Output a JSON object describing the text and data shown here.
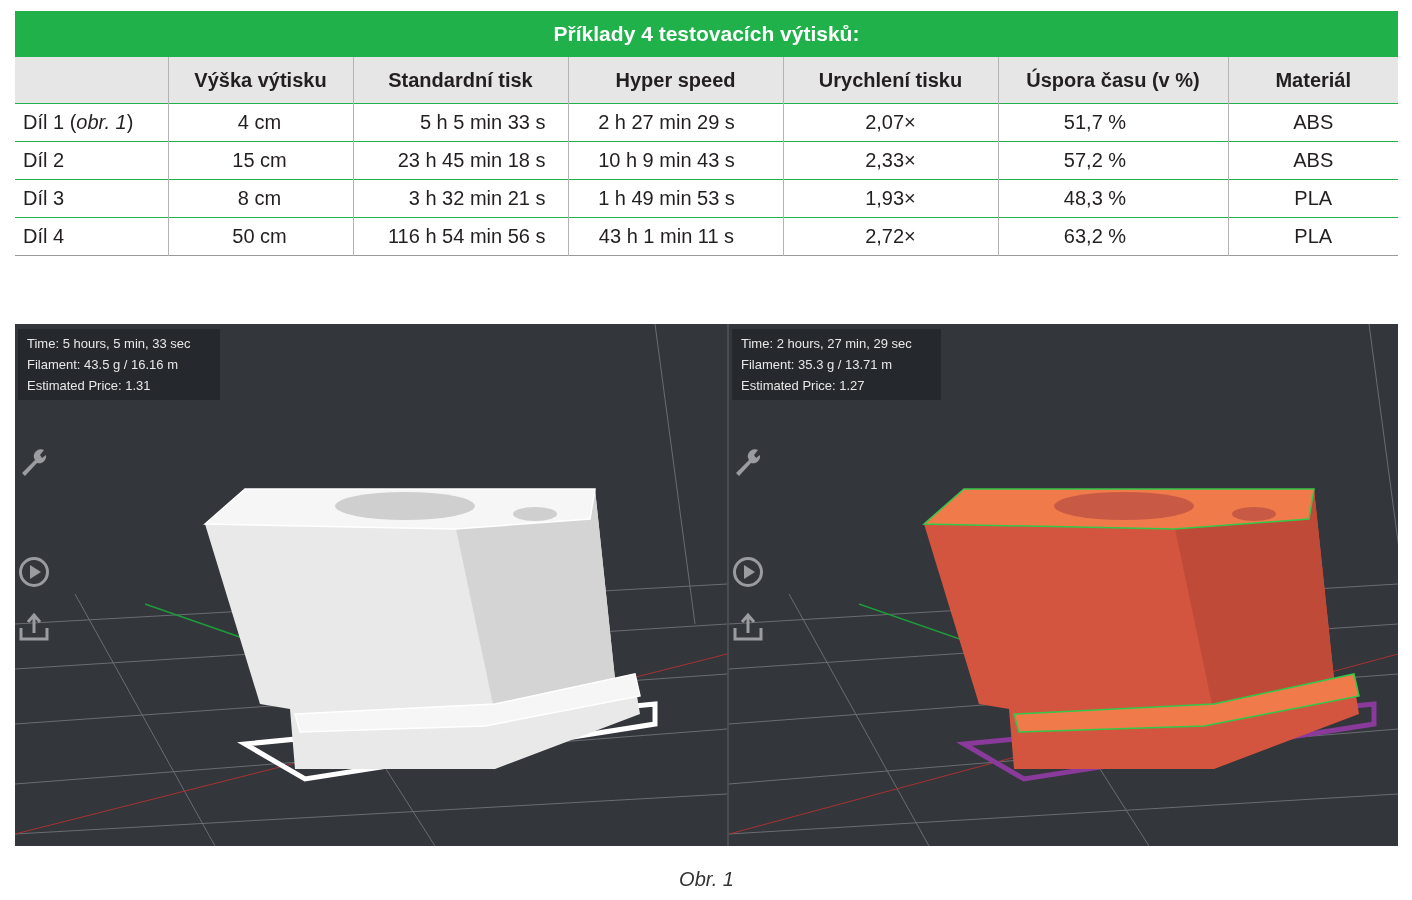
{
  "table": {
    "title": "Příklady 4 testovacích výtisků:",
    "columns": [
      "",
      "Výška výtisku",
      "Standardní tisk",
      "Hyper speed",
      "Urychlení tisku",
      "Úspora času (v %)",
      "Materiál"
    ],
    "rows": [
      [
        "Díl 1 (*obr. 1*)",
        "4 cm",
        "5 h 5 min 33 s",
        "2 h 27 min 29 s",
        "2,07×",
        "51,7 %",
        "ABS"
      ],
      [
        "Díl 2",
        "15 cm",
        "23 h 45 min 18 s",
        "10 h 9 min 43 s",
        "2,33×",
        "57,2 %",
        "ABS"
      ],
      [
        "Díl 3",
        "8 cm",
        "3 h 32 min 21 s",
        "1 h 49 min 53 s",
        "1,93×",
        "48,3 %",
        "PLA"
      ],
      [
        "Díl 4",
        "50 cm",
        "116 h 54 min 56 s",
        "43 h 1 min 11 s",
        "2,72×",
        "63,2 %",
        "PLA"
      ]
    ]
  },
  "views": [
    {
      "kind": "standard",
      "info": [
        "Time: 5 hours, 5 min, 33 sec",
        "Filament: 43.5 g / 16.16 m",
        "Estimated Price: 1.31"
      ]
    },
    {
      "kind": "hyper",
      "info": [
        "Time: 2 hours, 27 min, 29 sec",
        "Filament: 35.3 g / 13.71 m",
        "Estimated Price: 1.27"
      ]
    }
  ],
  "caption": "Obr. 1"
}
